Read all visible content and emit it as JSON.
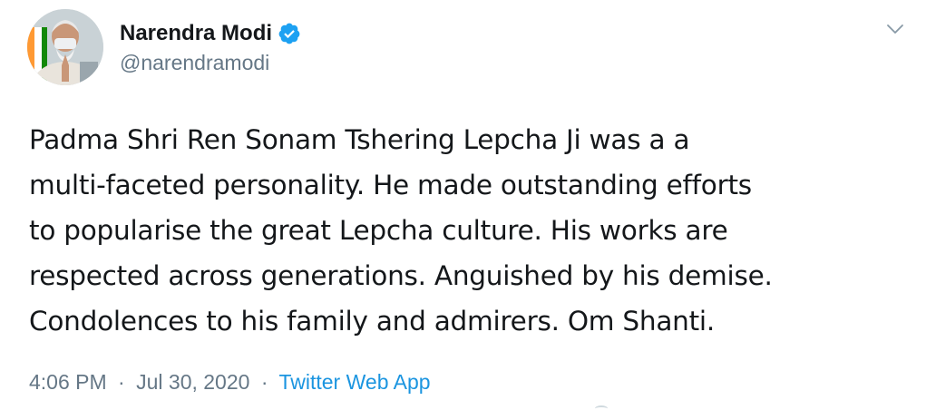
{
  "author": {
    "display_name": "Narendra Modi",
    "handle": "@narendramodi",
    "verified": true,
    "avatar_icon": "profile-photo"
  },
  "tweet": {
    "text_lines": [
      "Padma Shri Ren Sonam Tshering Lepcha Ji was a a",
      "multi-faceted personality. He made outstanding efforts",
      "to popularise the great Lepcha culture. His works are",
      "respected across generations. Anguished by his demise.",
      "Condolences to his family and admirers. Om Shanti."
    ]
  },
  "meta": {
    "time": "4:06 PM",
    "separator": "·",
    "date": "Jul 30, 2020",
    "source": "Twitter Web App"
  },
  "menu": {
    "caret_icon": "chevron-down-icon"
  },
  "colors": {
    "primary_text": "#14171a",
    "secondary_text": "#657786",
    "link": "#1b95e0",
    "verified": "#1da1f2"
  }
}
